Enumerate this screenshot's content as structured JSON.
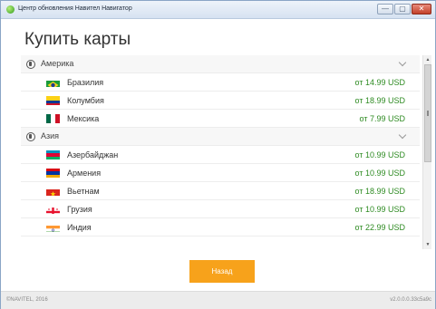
{
  "window": {
    "title": "Центр обновления Навител Навигатор",
    "controls": {
      "minimize": "—",
      "maximize": "▢",
      "close": "✕"
    }
  },
  "page": {
    "title": "Купить карты"
  },
  "groups": [
    {
      "label": "Америка",
      "items": [
        {
          "name": "Бразилия",
          "price": "от 14.99 USD"
        },
        {
          "name": "Колумбия",
          "price": "от 18.99 USD"
        },
        {
          "name": "Мексика",
          "price": "от 7.99 USD"
        }
      ]
    },
    {
      "label": "Азия",
      "items": [
        {
          "name": "Азербайджан",
          "price": "от 10.99 USD"
        },
        {
          "name": "Армения",
          "price": "от 10.99 USD"
        },
        {
          "name": "Вьетнам",
          "price": "от 18.99 USD"
        },
        {
          "name": "Грузия",
          "price": "от 10.99 USD"
        },
        {
          "name": "Индия",
          "price": "от 22.99 USD"
        }
      ]
    }
  ],
  "actions": {
    "back_label": "Назад"
  },
  "footer": {
    "copyright": "©NAVITEL, 2016",
    "version": "v2.0.0.0.33c5a9c"
  },
  "colors": {
    "accent": "#f7a21b",
    "price": "#2e8b22"
  }
}
